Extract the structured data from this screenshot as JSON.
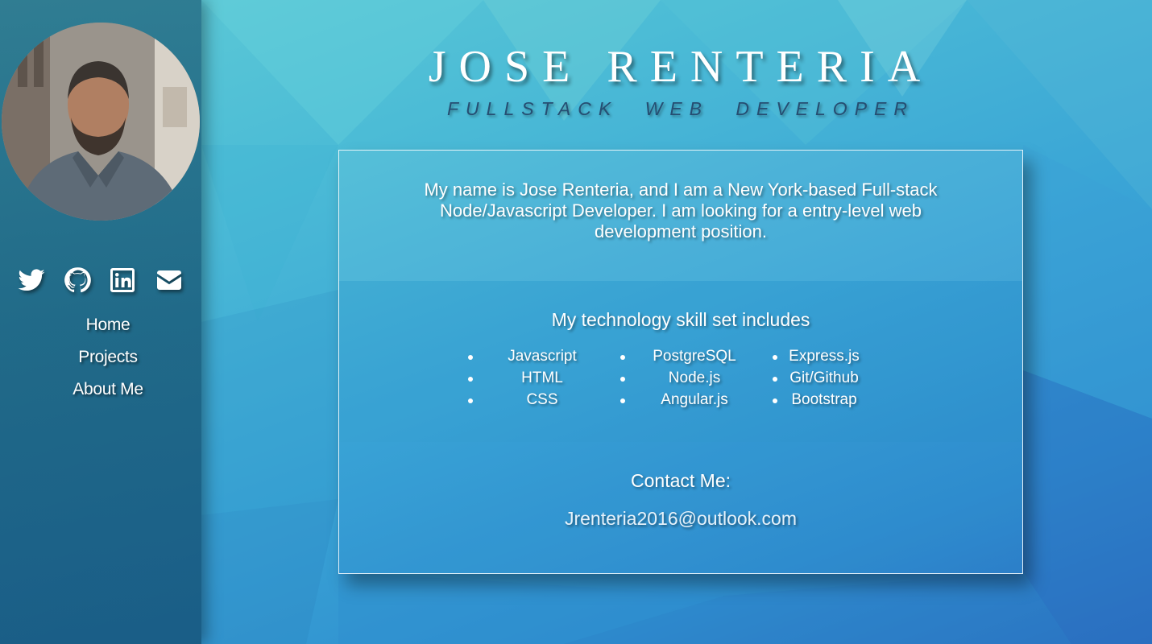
{
  "header": {
    "name": "JOSE RENTERIA",
    "tagline": "FULLSTACK WEB DEVELOPER"
  },
  "sidebar": {
    "avatar_icon": "profile-photo",
    "social": [
      {
        "icon": "twitter-icon"
      },
      {
        "icon": "github-icon"
      },
      {
        "icon": "linkedin-icon"
      },
      {
        "icon": "envelope-icon"
      }
    ],
    "nav": [
      {
        "label": "Home"
      },
      {
        "label": "Projects"
      },
      {
        "label": "About Me"
      }
    ]
  },
  "intro": {
    "text": "My name is Jose Renteria, and I am a New York-based Full-stack Node/Javascript Developer. I am looking for a entry-level web development position."
  },
  "skills": {
    "heading": "My technology skill set includes",
    "columns": [
      [
        "Javascript",
        "HTML",
        "CSS"
      ],
      [
        "PostgreSQL",
        "Node.js",
        "Angular.js"
      ],
      [
        "Express.js",
        "Git/Github",
        "Bootstrap"
      ]
    ]
  },
  "contact": {
    "heading": "Contact Me:",
    "email": "Jrenteria2016@outlook.com"
  },
  "colors": {
    "subtitle": "#264e72",
    "background_top": "#5fcbd6",
    "background_bottom": "#2b6fc0"
  }
}
